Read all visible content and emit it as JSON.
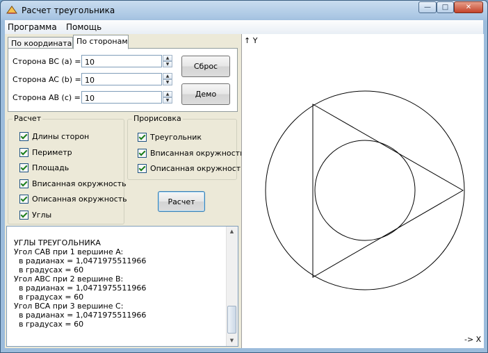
{
  "window": {
    "title": "Расчет треугольника",
    "buttons": {
      "minimize": "—",
      "maximize": "□",
      "close": "✕"
    }
  },
  "menu": {
    "items": [
      "Программа",
      "Помощь"
    ]
  },
  "tabs": [
    {
      "label": "По координатам",
      "active": false
    },
    {
      "label": "По сторонам",
      "active": true
    }
  ],
  "sides": [
    {
      "label": "Сторона BC (a) =",
      "value": "10"
    },
    {
      "label": "Сторона AC (b) =",
      "value": "10"
    },
    {
      "label": "Сторона AB (c) =",
      "value": "10"
    }
  ],
  "buttons": {
    "reset": "Сброс",
    "demo": "Демо",
    "calculate": "Расчет"
  },
  "calc_group": {
    "title": "Расчет",
    "options": [
      {
        "label": "Длины сторон",
        "checked": true
      },
      {
        "label": "Периметр",
        "checked": true
      },
      {
        "label": "Площадь",
        "checked": true
      },
      {
        "label": "Вписанная окружность",
        "checked": true
      },
      {
        "label": "Описанная окружность",
        "checked": true
      },
      {
        "label": "Углы",
        "checked": true
      }
    ]
  },
  "draw_group": {
    "title": "Прорисовка",
    "options": [
      {
        "label": "Треугольник",
        "checked": true
      },
      {
        "label": "Вписанная окружность",
        "checked": true
      },
      {
        "label": "Описанная окружность",
        "checked": true
      }
    ]
  },
  "output": {
    "lines": [
      "УГЛЫ ТРЕУГОЛЬНИКА",
      "Угол CAB при 1 вершине A:",
      "  в радианах = 1,0471975511966",
      "  в градусах = 60",
      "Угол ABC при 2 вершине B:",
      "  в радианах = 1,0471975511966",
      "  в градусах = 60",
      "Угол BCA при 3 вершине C:",
      "  в радианах = 1,0471975511966",
      "  в градусах = 60"
    ]
  },
  "plot": {
    "y_axis_label": "↑ Y",
    "x_axis_label": "-> X"
  }
}
